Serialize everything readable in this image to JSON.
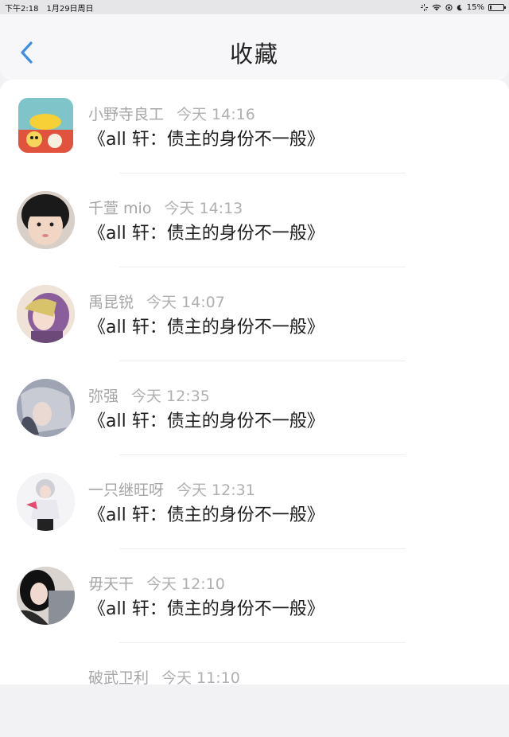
{
  "status_bar": {
    "time": "下午2:18",
    "date": "1月29日周日",
    "battery": "15%",
    "battery_level": 0.15
  },
  "header": {
    "title": "收藏"
  },
  "items": [
    {
      "name": "小野寺良工",
      "time": "今天 14:16",
      "message": "《all 轩：债主的身份不一般》"
    },
    {
      "name": "千萱 mio",
      "time": "今天 14:13",
      "message": "《all 轩：债主的身份不一般》"
    },
    {
      "name": "禹昆锐",
      "time": "今天 14:07",
      "message": "《all 轩：债主的身份不一般》"
    },
    {
      "name": "弥强",
      "time": "今天 12:35",
      "message": "《all 轩：债主的身份不一般》"
    },
    {
      "name": "一只继旺呀",
      "time": "今天 12:31",
      "message": "《all 轩：债主的身份不一般》"
    },
    {
      "name": "毋天干",
      "time": "今天 12:10",
      "message": "《all 轩：债主的身份不一般》"
    },
    {
      "name": "破武卫利",
      "time": "今天 11:10",
      "message": ""
    }
  ]
}
